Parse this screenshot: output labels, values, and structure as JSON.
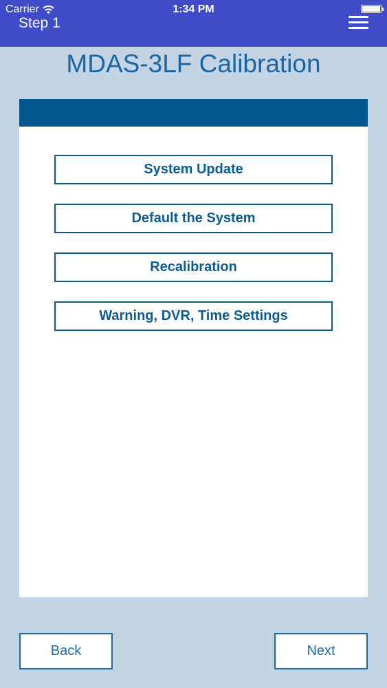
{
  "status_bar": {
    "carrier": "Carrier",
    "time": "1:34 PM"
  },
  "header": {
    "step": "Step 1",
    "menu_icon": "hamburger-menu-icon"
  },
  "page": {
    "title": "MDAS-3LF Calibration"
  },
  "options": [
    {
      "label": "System Update"
    },
    {
      "label": "Default the System"
    },
    {
      "label": "Recalibration"
    },
    {
      "label": "Warning, DVR, Time Settings"
    }
  ],
  "footer": {
    "back_label": "Back",
    "next_label": "Next"
  },
  "colors": {
    "header_bg": "#3f4bc7",
    "page_bg": "#c3d5e5",
    "panel_header": "#03568e",
    "accent": "#0a5c95"
  }
}
